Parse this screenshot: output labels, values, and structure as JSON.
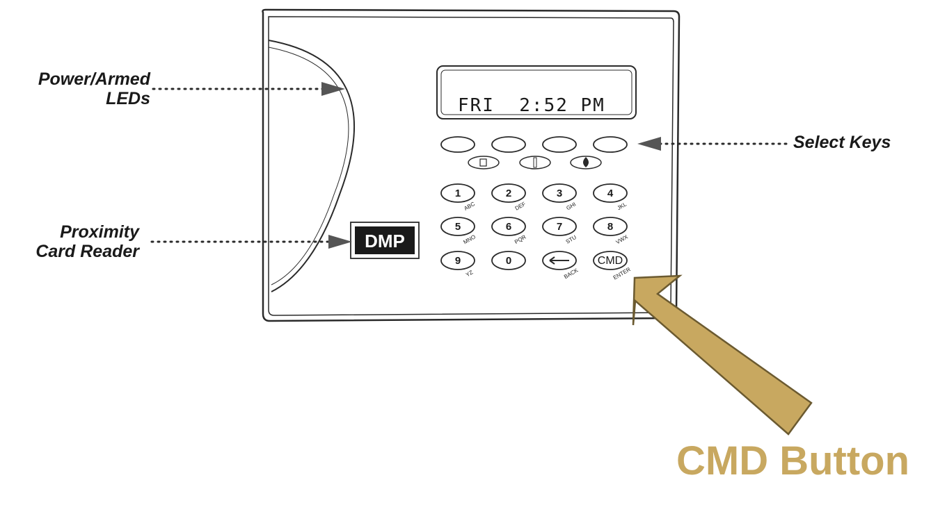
{
  "labels": {
    "power_armed_line1": "Power/Armed",
    "power_armed_line2": "LEDs",
    "select_keys": "Select Keys",
    "proximity_line1": "Proximity",
    "proximity_line2": "Card Reader",
    "cmd_button": "CMD Button"
  },
  "display": {
    "text": "FRI  2:52 PM"
  },
  "keypad": {
    "keys": [
      {
        "digit": "1",
        "sub": "ABC"
      },
      {
        "digit": "2",
        "sub": "DEF"
      },
      {
        "digit": "3",
        "sub": "GHI"
      },
      {
        "digit": "4",
        "sub": "JKL"
      },
      {
        "digit": "5",
        "sub": "MNO"
      },
      {
        "digit": "6",
        "sub": "PQR"
      },
      {
        "digit": "7",
        "sub": "STU"
      },
      {
        "digit": "8",
        "sub": "VWX"
      },
      {
        "digit": "9",
        "sub": "YZ"
      },
      {
        "digit": "0",
        "sub": ""
      },
      {
        "digit": "",
        "sub": "BACK"
      },
      {
        "digit": "CMD",
        "sub": "ENTER"
      }
    ],
    "logo_text": "DMP"
  },
  "colors": {
    "arrow_fill": "#c8a860",
    "arrow_stroke": "#6b5a30",
    "line": "#2a2a2a"
  }
}
